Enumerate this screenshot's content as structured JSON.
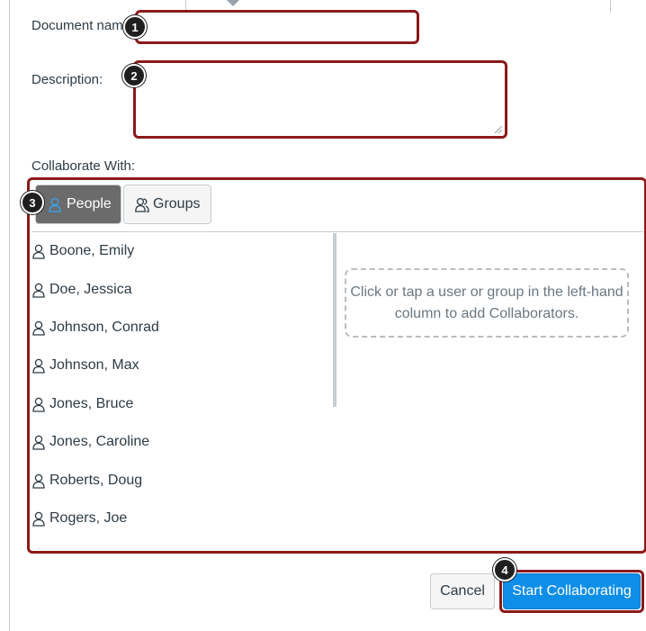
{
  "form": {
    "document_name_label": "Document name",
    "document_name_value": "",
    "description_label": "Description:",
    "description_value": "",
    "collaborate_with_label": "Collaborate With:"
  },
  "tabs": [
    {
      "label": "People",
      "icon": "person-icon",
      "active": true
    },
    {
      "label": "Groups",
      "icon": "group-icon",
      "active": false
    }
  ],
  "people": [
    {
      "name": "Boone, Emily"
    },
    {
      "name": "Doe, Jessica"
    },
    {
      "name": "Johnson, Conrad"
    },
    {
      "name": "Johnson, Max"
    },
    {
      "name": "Jones, Bruce"
    },
    {
      "name": "Jones, Caroline"
    },
    {
      "name": "Roberts, Doug"
    },
    {
      "name": "Rogers, Joe"
    }
  ],
  "dropzone_text": "Click or tap a user or group in the left-hand column to add Collaborators.",
  "buttons": {
    "cancel": "Cancel",
    "start": "Start Collaborating"
  },
  "callouts": [
    "1",
    "2",
    "3",
    "4"
  ],
  "colors": {
    "highlight": "#8b1a1a",
    "primary": "#0d8ee8",
    "active_tab": "#6b6b6b"
  }
}
